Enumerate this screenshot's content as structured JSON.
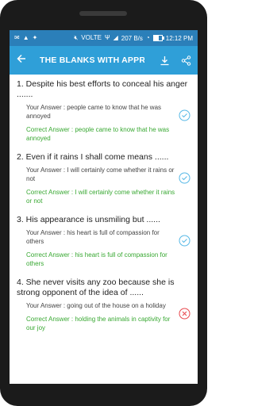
{
  "status_bar": {
    "carrier_label": "VOLTE",
    "speed": "207 B/s",
    "time": "12:12 PM",
    "battery_fill": 0.6
  },
  "toolbar": {
    "title": "THE BLANKS WITH APPRO"
  },
  "questions": [
    {
      "question": "1. Despite his best efforts to conceal his anger .......",
      "your_answer": "Your Answer : people came to know that he was annoyed",
      "correct_answer": "Correct Answer : people came to know that he was annoyed",
      "result": "correct"
    },
    {
      "question": "2. Even if it rains I shall come means ......",
      "your_answer": "Your Answer : I will certainly come whether it rains or not",
      "correct_answer": "Correct Answer : I will certainly come whether it rains or not",
      "result": "correct"
    },
    {
      "question": "3. His appearance is unsmiling but ......",
      "your_answer": "Your Answer : his heart is full of compassion for others",
      "correct_answer": "Correct Answer : his heart is full of compassion for others",
      "result": "correct"
    },
    {
      "question": "4. She never visits any zoo because she is strong opponent of the idea of ......",
      "your_answer": "Your Answer : going out of the house on a holiday",
      "correct_answer": "Correct Answer : holding the animals in captivity for our joy",
      "result": "wrong"
    }
  ],
  "colors": {
    "status_bar": "#2b7fb9",
    "toolbar": "#2f9fd8",
    "correct_text": "#38a832",
    "correct_icon": "#56b8e6",
    "wrong_icon": "#e8474c"
  }
}
